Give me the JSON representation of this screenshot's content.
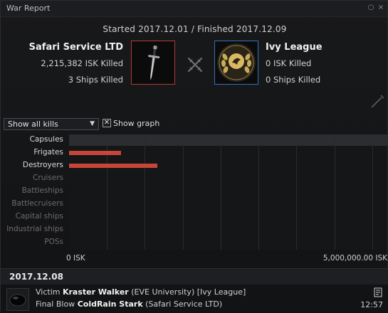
{
  "window": {
    "title": "War Report"
  },
  "period": {
    "started_label": "Started",
    "started": "2017.12.01",
    "separator": "/",
    "finished_label": "Finished",
    "finished": "2017.12.09"
  },
  "aggressor": {
    "name": "Safari Service LTD",
    "isk_killed": "2,215,382 ISK Killed",
    "ships_killed": "3 Ships Killed",
    "color": "#b03a2e"
  },
  "defender": {
    "name": "Ivy League",
    "isk_killed": "0 ISK Killed",
    "ships_killed": "0 Ships Killed",
    "color": "#3a6fb8"
  },
  "controls": {
    "filter_value": "Show all kills",
    "show_graph_label": "Show graph",
    "show_graph_checked": true
  },
  "chart_data": {
    "type": "bar",
    "orientation": "horizontal",
    "categories": [
      "Capsules",
      "Frigates",
      "Destroyers",
      "Cruisers",
      "Battleships",
      "Battlecruisers",
      "Capital ships",
      "Industrial ships",
      "POSs"
    ],
    "values": [
      0,
      820000,
      1390000,
      0,
      0,
      0,
      0,
      0,
      0
    ],
    "active": [
      true,
      true,
      true,
      false,
      false,
      false,
      false,
      false,
      false
    ],
    "xlim": [
      0,
      5000000
    ],
    "xlabel_min": "0 ISK",
    "xlabel_max": "5,000,000.00 ISK",
    "bar_color": "#c8453a",
    "grid": true
  },
  "kills": {
    "date": "2017.12.08",
    "entries": [
      {
        "victim_label": "Victim",
        "victim_name": "Kraster Walker",
        "victim_corp": "EVE University",
        "victim_alliance": "Ivy League",
        "final_blow_label": "Final Blow",
        "final_blow_name": "ColdRain Stark",
        "final_blow_corp": "Safari Service LTD",
        "time": "12:57"
      }
    ]
  },
  "icons": {
    "minimize": "minimize-icon",
    "close": "close-icon",
    "vs": "crossed-swords-icon",
    "sword": "sword-icon",
    "laurel": "laurel-emblem-icon",
    "doc": "document-icon"
  }
}
